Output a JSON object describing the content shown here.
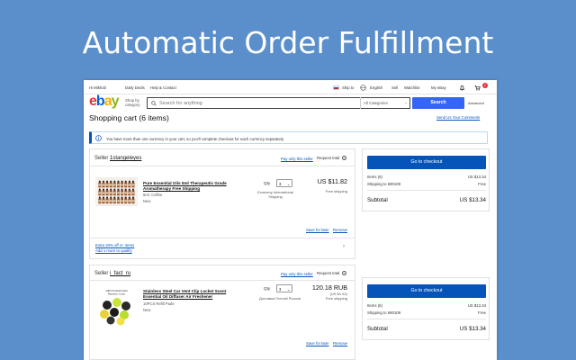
{
  "headline": "Automatic Order Fulfillment",
  "topbar": {
    "greeting": "Hi Mikhail",
    "links": [
      "Daily Deals",
      "Help & Contact"
    ],
    "ship_to": "Ship to",
    "language": "English",
    "sell": "Sell",
    "watchlist": "Watchlist",
    "my_ebay": "My eBay",
    "cart_count": "2"
  },
  "logo": {
    "e": "e",
    "b": "b",
    "a": "a",
    "y": "y"
  },
  "header": {
    "shop_by_category": [
      "Shop by",
      "category"
    ],
    "search_placeholder": "Search for anything",
    "category": "All Categories",
    "search_button": "Search",
    "advanced": "Advanced"
  },
  "cart": {
    "title": "Shopping cart (6 items)",
    "feedback_link": "Send Us Your Comments",
    "notice": "You have more than one currency in your cart, so you'll complete checkout for each currency separately."
  },
  "sellers": [
    {
      "label": "Seller",
      "name": "1stangeleyes",
      "pay_only": "Pay only this seller",
      "request_total": "Request total",
      "item": {
        "title": "Pure Essential Oils 5ml Therapeutic Grade Aromatherapy Free Shipping",
        "variant": "5ml, Coffee",
        "condition": "New",
        "qty_label": "Qty",
        "qty": "3",
        "shipping_method": [
          "Economy International",
          "Shipping"
        ],
        "price": "US $11.82",
        "price_sub": [
          "Free shipping"
        ],
        "save_for_later": "Save for later",
        "remove": "Remove"
      },
      "promo": [
        "Extra 20% off 4+ items",
        "Add 1 more to qualify"
      ]
    },
    {
      "label": "Seller",
      "name": "i_fact_ru",
      "pay_only": "Pay only this seller",
      "request_total": "Request total",
      "item": {
        "title": "Stainless Steel Car Vent Clip Locket Scent Essential Oil Diffuser Air Freshener",
        "variant": "10PCS Refill Pads",
        "condition": "New",
        "thumb_caption": [
          "10PCS Refill Pads",
          "Random Color"
        ],
        "qty_label": "Qty",
        "qty": "3",
        "shipping_method": [
          "Доставка Почтой России"
        ],
        "price": "120.18 RUB",
        "price_sub": [
          "(US $1.52)",
          "Free shipping"
        ],
        "save_for_later": "Save for later",
        "remove": "Remove"
      }
    }
  ],
  "summaries": [
    {
      "checkout": "Go to checkout",
      "items_label": "Items (6)",
      "items_value": "US $13.34",
      "shipping_label": "Shipping to 690109",
      "shipping_value": "Free",
      "subtotal_label": "Subtotal",
      "subtotal_value": "US $13.34"
    },
    {
      "checkout": "Go to checkout",
      "items_label": "Items (6)",
      "items_value": "US $13.34",
      "shipping_label": "Shipping to 690109",
      "shipping_value": "Free",
      "subtotal_label": "Subtotal",
      "subtotal_value": "US $13.34"
    }
  ],
  "colors": {
    "background": "#5b8fcc",
    "link": "#0654ba",
    "search_button": "#3665f3",
    "checkout_button": "#0654ba"
  }
}
